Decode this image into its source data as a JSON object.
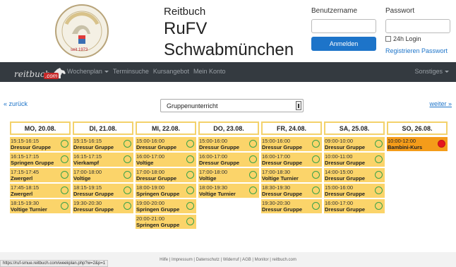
{
  "brand": {
    "line1": "Reitbuch",
    "line2": "RuFV",
    "line3": "Schwabmünchen"
  },
  "logo": {
    "text_top": "Reit- und Fahrverein",
    "text_bottom": "Schwabmünchen",
    "founded": "seit 1973"
  },
  "login": {
    "username_label": "Benutzername",
    "password_label": "Passwort",
    "button": "Anmelden",
    "remember": "24h Login",
    "reset_link": "Registrieren Passwort"
  },
  "nav": {
    "logo_text": "reitbuch",
    "logo_suffix": ".com",
    "items": [
      {
        "label": "Wochenplan",
        "active": true,
        "dropdown": true
      },
      {
        "label": "Terminsuche",
        "active": false
      },
      {
        "label": "Kursangebot",
        "active": false
      },
      {
        "label": "Mein Konto",
        "active": false
      }
    ],
    "right": "Sonstiges"
  },
  "controls": {
    "prev": "« zurück",
    "next": "weiter »",
    "filter": "Gruppenunterricht"
  },
  "days": [
    {
      "label": "MO, 20.08.",
      "slots": [
        {
          "time": "15:15-16:15",
          "name": "Dressur Gruppe"
        },
        {
          "time": "16:15-17:15",
          "name": "Springen Gruppe"
        },
        {
          "time": "17:15-17:45",
          "name": "Zwergerl"
        },
        {
          "time": "17:45-18:15",
          "name": "Zwergerl"
        },
        {
          "time": "18:15-19:30",
          "name": "Voltige Turnier"
        }
      ]
    },
    {
      "label": "DI, 21.08.",
      "slots": [
        {
          "time": "15:15-16:15",
          "name": "Dressur Gruppe"
        },
        {
          "time": "16:15-17:15",
          "name": "Vierkampf"
        },
        {
          "time": "17:00-18:00",
          "name": "Voltige"
        },
        {
          "time": "18:15-19:15",
          "name": "Dressur Gruppe"
        },
        {
          "time": "19:30-20:30",
          "name": "Dressur Gruppe"
        }
      ]
    },
    {
      "label": "MI, 22.08.",
      "slots": [
        {
          "time": "15:00-16:00",
          "name": "Dressur Gruppe"
        },
        {
          "time": "16:00-17:00",
          "name": "Voltige"
        },
        {
          "time": "17:00-18:00",
          "name": "Dressur Gruppe"
        },
        {
          "time": "18:00-19:00",
          "name": "Springen Gruppe"
        },
        {
          "time": "19:00-20:00",
          "name": "Springen Gruppe"
        },
        {
          "time": "20:00-21:00",
          "name": "Springen Gruppe"
        }
      ]
    },
    {
      "label": "DO, 23.08.",
      "slots": [
        {
          "time": "15:00-16:00",
          "name": "Dressur Gruppe"
        },
        {
          "time": "16:00-17:00",
          "name": "Dressur Gruppe"
        },
        {
          "time": "17:00-18:00",
          "name": "Voltige"
        },
        {
          "time": "18:00-19:30",
          "name": "Voltige Turnier"
        }
      ]
    },
    {
      "label": "FR, 24.08.",
      "slots": [
        {
          "time": "15:00-16:00",
          "name": "Dressur Gruppe"
        },
        {
          "time": "16:00-17:00",
          "name": "Dressur Gruppe"
        },
        {
          "time": "17:00-18:30",
          "name": "Voltige Turnier"
        },
        {
          "time": "18:30-19:30",
          "name": "Dressur Gruppe"
        },
        {
          "time": "19:30-20:30",
          "name": "Dressur Gruppe"
        }
      ]
    },
    {
      "label": "SA, 25.08.",
      "slots": [
        {
          "time": "09:00-10:00",
          "name": "Dressur Gruppe"
        },
        {
          "time": "10:00-11:00",
          "name": "Dressur Gruppe"
        },
        {
          "time": "14:00-15:00",
          "name": "Dressur Gruppe"
        },
        {
          "time": "15:00-16:00",
          "name": "Dressur Gruppe"
        },
        {
          "time": "16:00-17:00",
          "name": "Dressur Gruppe"
        }
      ]
    },
    {
      "label": "SO, 26.08.",
      "slots": [
        {
          "time": "10:00-12:00",
          "name": "Bambini-Kurs",
          "full": true
        }
      ]
    }
  ],
  "footer": "Hilfe | Impressum | Datenschutz | Widerruf | AGB | Monitor | reitbuch.com",
  "status_url": "https://ruf-smue.reitbuch.com/weekplan.php?w=2&p=1",
  "colors": {
    "slot": "#fbd46a",
    "slot_full": "#f49c1a",
    "free_icon": "#3aa24a",
    "full_icon": "#e5161d",
    "navbar": "#343a40",
    "link": "#1d74c9"
  }
}
